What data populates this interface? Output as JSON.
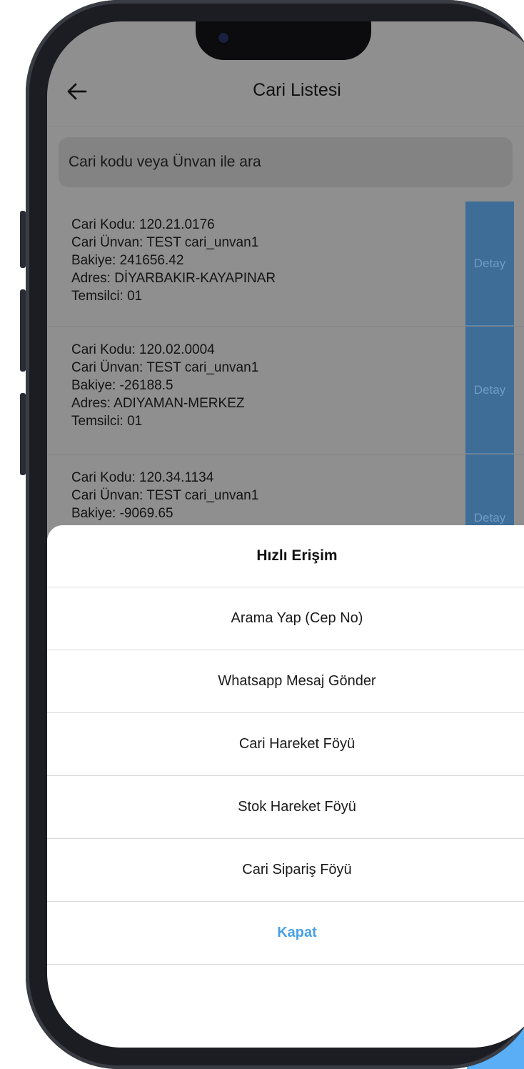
{
  "header": {
    "back_icon": "arrow-left-icon",
    "title": "Cari Listesi"
  },
  "search": {
    "placeholder": "Cari kodu veya Ünvan ile ara"
  },
  "list": {
    "detail_label": "Detay",
    "items": [
      {
        "code": "Cari Kodu: 120.21.0176",
        "title": "Cari Ünvan: TEST cari_unvan1",
        "balance": "Bakiye: 241656.42",
        "address": "Adres: DİYARBAKIR-KAYAPINAR",
        "rep": "Temsilci: 01"
      },
      {
        "code": "Cari Kodu: 120.02.0004",
        "title": "Cari Ünvan: TEST cari_unvan1",
        "balance": "Bakiye: -26188.5",
        "address": "Adres: ADIYAMAN-MERKEZ",
        "rep": "Temsilci: 01"
      },
      {
        "code": "Cari Kodu: 120.34.1134",
        "title": "Cari Ünvan: TEST cari_unvan1",
        "balance": "Bakiye: -9069.65"
      }
    ]
  },
  "sheet": {
    "title": "Hızlı Erişim",
    "options": [
      "Arama Yap (Cep No)",
      "Whatsapp Mesaj Gönder",
      "Cari Hareket Föyü",
      "Stok Hareket Föyü",
      "Cari Sipariş Föyü"
    ],
    "close_label": "Kapat"
  },
  "colors": {
    "overlay": "#8f8f8f",
    "detail_button": "#3e6d98",
    "close_text": "#4aa0e6",
    "accent": "#5aaef5"
  }
}
